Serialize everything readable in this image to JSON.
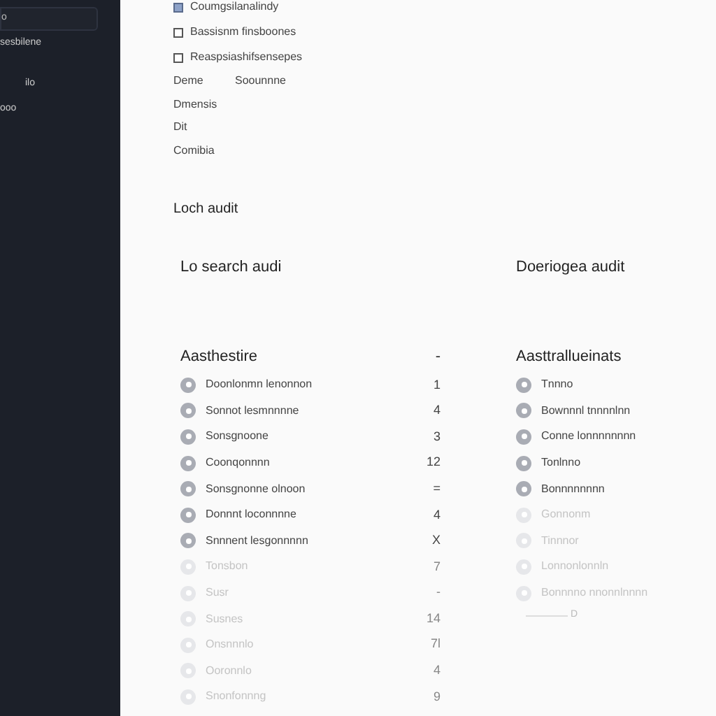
{
  "sidebar": {
    "search": {
      "value": "o"
    },
    "items": [
      {
        "label": "sesbilene"
      },
      {
        "label": "ilo"
      },
      {
        "label": "ooo"
      }
    ]
  },
  "checklist": [
    {
      "label": "Coumgsilanalindy",
      "checked": true
    },
    {
      "label": "Bassisnm finsboones",
      "checked": false
    },
    {
      "label": "Reaspsiashifsensepes",
      "checked": false
    }
  ],
  "details": [
    {
      "label": "Deme",
      "value": "Soounnne"
    },
    {
      "label": "Dmensis"
    },
    {
      "label": "Dit"
    },
    {
      "label": "Comibia"
    }
  ],
  "section_title": "Loch audit",
  "columns": [
    {
      "title": "Lo search audi",
      "heading": "Aasthestire",
      "heading_mark": "-",
      "items": [
        {
          "label": "Doonlonmn lenonnon",
          "count": "1",
          "dimmed": false
        },
        {
          "label": "Sonnot lesmnnnne",
          "count": "4",
          "dimmed": false
        },
        {
          "label": "Sonsgnoone",
          "count": "3",
          "dimmed": false
        },
        {
          "label": "Coonqonnnn",
          "count": "12",
          "dimmed": false
        },
        {
          "label": "Sonsgnonne olnoon",
          "count": "=",
          "dimmed": false
        },
        {
          "label": "Donnnt loconnnne",
          "count": "4",
          "dimmed": false
        },
        {
          "label": "Snnnent lesgonnnnn",
          "count": "X",
          "dimmed": false
        },
        {
          "label": "Tonsbon",
          "count": "7",
          "dimmed": true
        },
        {
          "label": "Susr",
          "count": "-",
          "dimmed": true
        },
        {
          "label": "Susnes",
          "count": "14",
          "dimmed": true
        },
        {
          "label": "Onsnnnlo",
          "count": "7l",
          "dimmed": true
        },
        {
          "label": "Ooronnlo",
          "count": "4",
          "dimmed": true
        },
        {
          "label": "Snonfonnng",
          "count": "9",
          "dimmed": true
        }
      ]
    },
    {
      "title": "Doeriogea audit",
      "heading": "Aasttrallueinats",
      "items": [
        {
          "label": "Tnnno",
          "dimmed": false
        },
        {
          "label": "Bownnnl tnnnnlnn",
          "dimmed": false
        },
        {
          "label": "Conne lonnnnnnnn",
          "dimmed": false
        },
        {
          "label": "Tonlnno",
          "dimmed": false
        },
        {
          "label": "Bonnnnnnnn",
          "dimmed": false
        },
        {
          "label": "Gonnonm",
          "dimmed": true
        },
        {
          "label": "Tinnnor",
          "dimmed": true
        },
        {
          "label": "Lonnonlonnln",
          "dimmed": true
        },
        {
          "label": "Bonnnno nnonnlnnnn",
          "dimmed": true
        }
      ],
      "footer": "D"
    }
  ]
}
